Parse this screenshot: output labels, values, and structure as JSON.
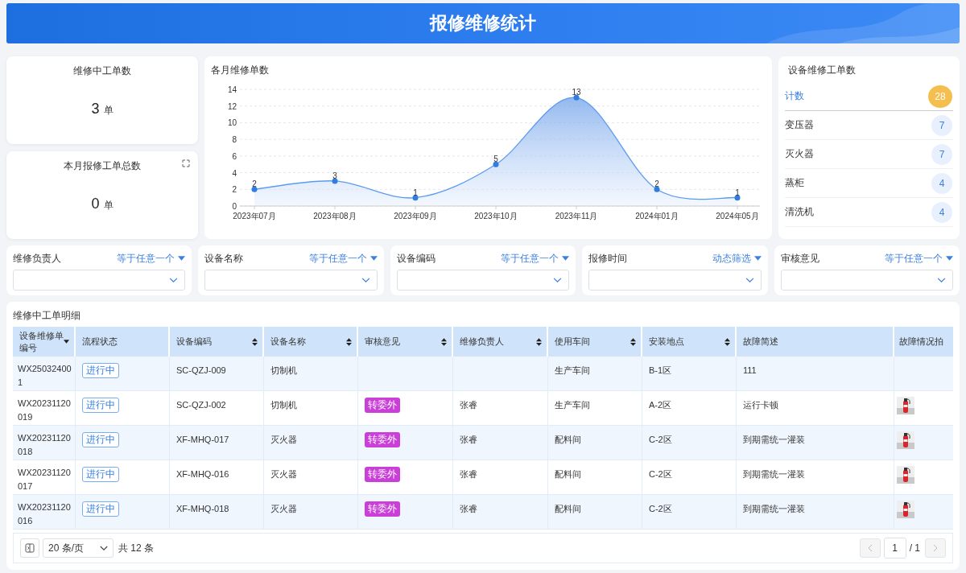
{
  "header": {
    "title": "报修维修统计"
  },
  "stat_cards": [
    {
      "title": "维修中工单数",
      "value": "3",
      "unit": "单",
      "expand_icon": false
    },
    {
      "title": "本月报修工单总数",
      "value": "0",
      "unit": "单",
      "expand_icon": true
    }
  ],
  "monthly_chart": {
    "title": "各月维修单数",
    "chart_data": {
      "type": "area",
      "categories": [
        "2023年07月",
        "2023年08月",
        "2023年09月",
        "2023年10月",
        "2023年11月",
        "2024年01月",
        "2024年05月"
      ],
      "series": [
        {
          "color": "#5b9bf0",
          "values": [
            2,
            3,
            1,
            5,
            13,
            2,
            1
          ]
        }
      ],
      "grid": true,
      "ylim": [
        0,
        14
      ],
      "yticks": [
        0,
        2,
        4,
        6,
        8,
        10,
        12,
        14
      ],
      "data_labels": true
    }
  },
  "device_counts": {
    "title": "设备维修工单数",
    "items": [
      {
        "kind": "total",
        "label": "计数",
        "count": "28"
      },
      {
        "kind": "item",
        "label": "变压器",
        "count": "7"
      },
      {
        "kind": "item",
        "label": "灭火器",
        "count": "7"
      },
      {
        "kind": "item",
        "label": "蒸柜",
        "count": "4"
      },
      {
        "kind": "item",
        "label": "清洗机",
        "count": "4"
      }
    ]
  },
  "filters": [
    {
      "label": "维修负责人",
      "operator": "等于任意一个"
    },
    {
      "label": "设备名称",
      "operator": "等于任意一个"
    },
    {
      "label": "设备编码",
      "operator": "等于任意一个"
    },
    {
      "label": "报修时间",
      "operator": "动态筛选"
    },
    {
      "label": "审核意见",
      "operator": "等于任意一个"
    }
  ],
  "table": {
    "title": "维修中工单明细",
    "columns": [
      {
        "label": "设备维修单编号",
        "sorted": true
      },
      {
        "label": "流程状态"
      },
      {
        "label": "设备编码",
        "sorted": false
      },
      {
        "label": "设备名称",
        "sorted": false
      },
      {
        "label": "审核意见",
        "sorted": false
      },
      {
        "label": "维修负责人",
        "sorted": false
      },
      {
        "label": "使用车间",
        "sorted": false
      },
      {
        "label": "安装地点",
        "sorted": false
      },
      {
        "label": "故障简述"
      },
      {
        "label": "故障情况拍"
      }
    ],
    "rows": [
      {
        "id": "WX250324001",
        "status": "进行中",
        "code": "SC-QZJ-009",
        "name": "切制机",
        "audit": "",
        "owner": "",
        "workshop": "生产车间",
        "location": "B-1区",
        "fault": "111"
      },
      {
        "id": "WX20231120019",
        "status": "进行中",
        "code": "SC-QZJ-002",
        "name": "切制机",
        "audit": "转委外",
        "owner": "张睿",
        "workshop": "生产车间",
        "location": "A-2区",
        "fault": "运行卡顿"
      },
      {
        "id": "WX20231120018",
        "status": "进行中",
        "code": "XF-MHQ-017",
        "name": "灭火器",
        "audit": "转委外",
        "owner": "张睿",
        "workshop": "配料间",
        "location": "C-2区",
        "fault": "到期需统一灌装"
      },
      {
        "id": "WX20231120017",
        "status": "进行中",
        "code": "XF-MHQ-016",
        "name": "灭火器",
        "audit": "转委外",
        "owner": "张睿",
        "workshop": "配料间",
        "location": "C-2区",
        "fault": "到期需统一灌装"
      },
      {
        "id": "WX20231120016",
        "status": "进行中",
        "code": "XF-MHQ-018",
        "name": "灭火器",
        "audit": "转委外",
        "owner": "张睿",
        "workshop": "配料间",
        "location": "C-2区",
        "fault": "到期需统一灌装"
      }
    ]
  },
  "pagination": {
    "page_size": "20 条/页",
    "total": "共 12 条",
    "page": "1",
    "pages": "/ 1",
    "prev_disabled": true,
    "next_disabled": true
  }
}
